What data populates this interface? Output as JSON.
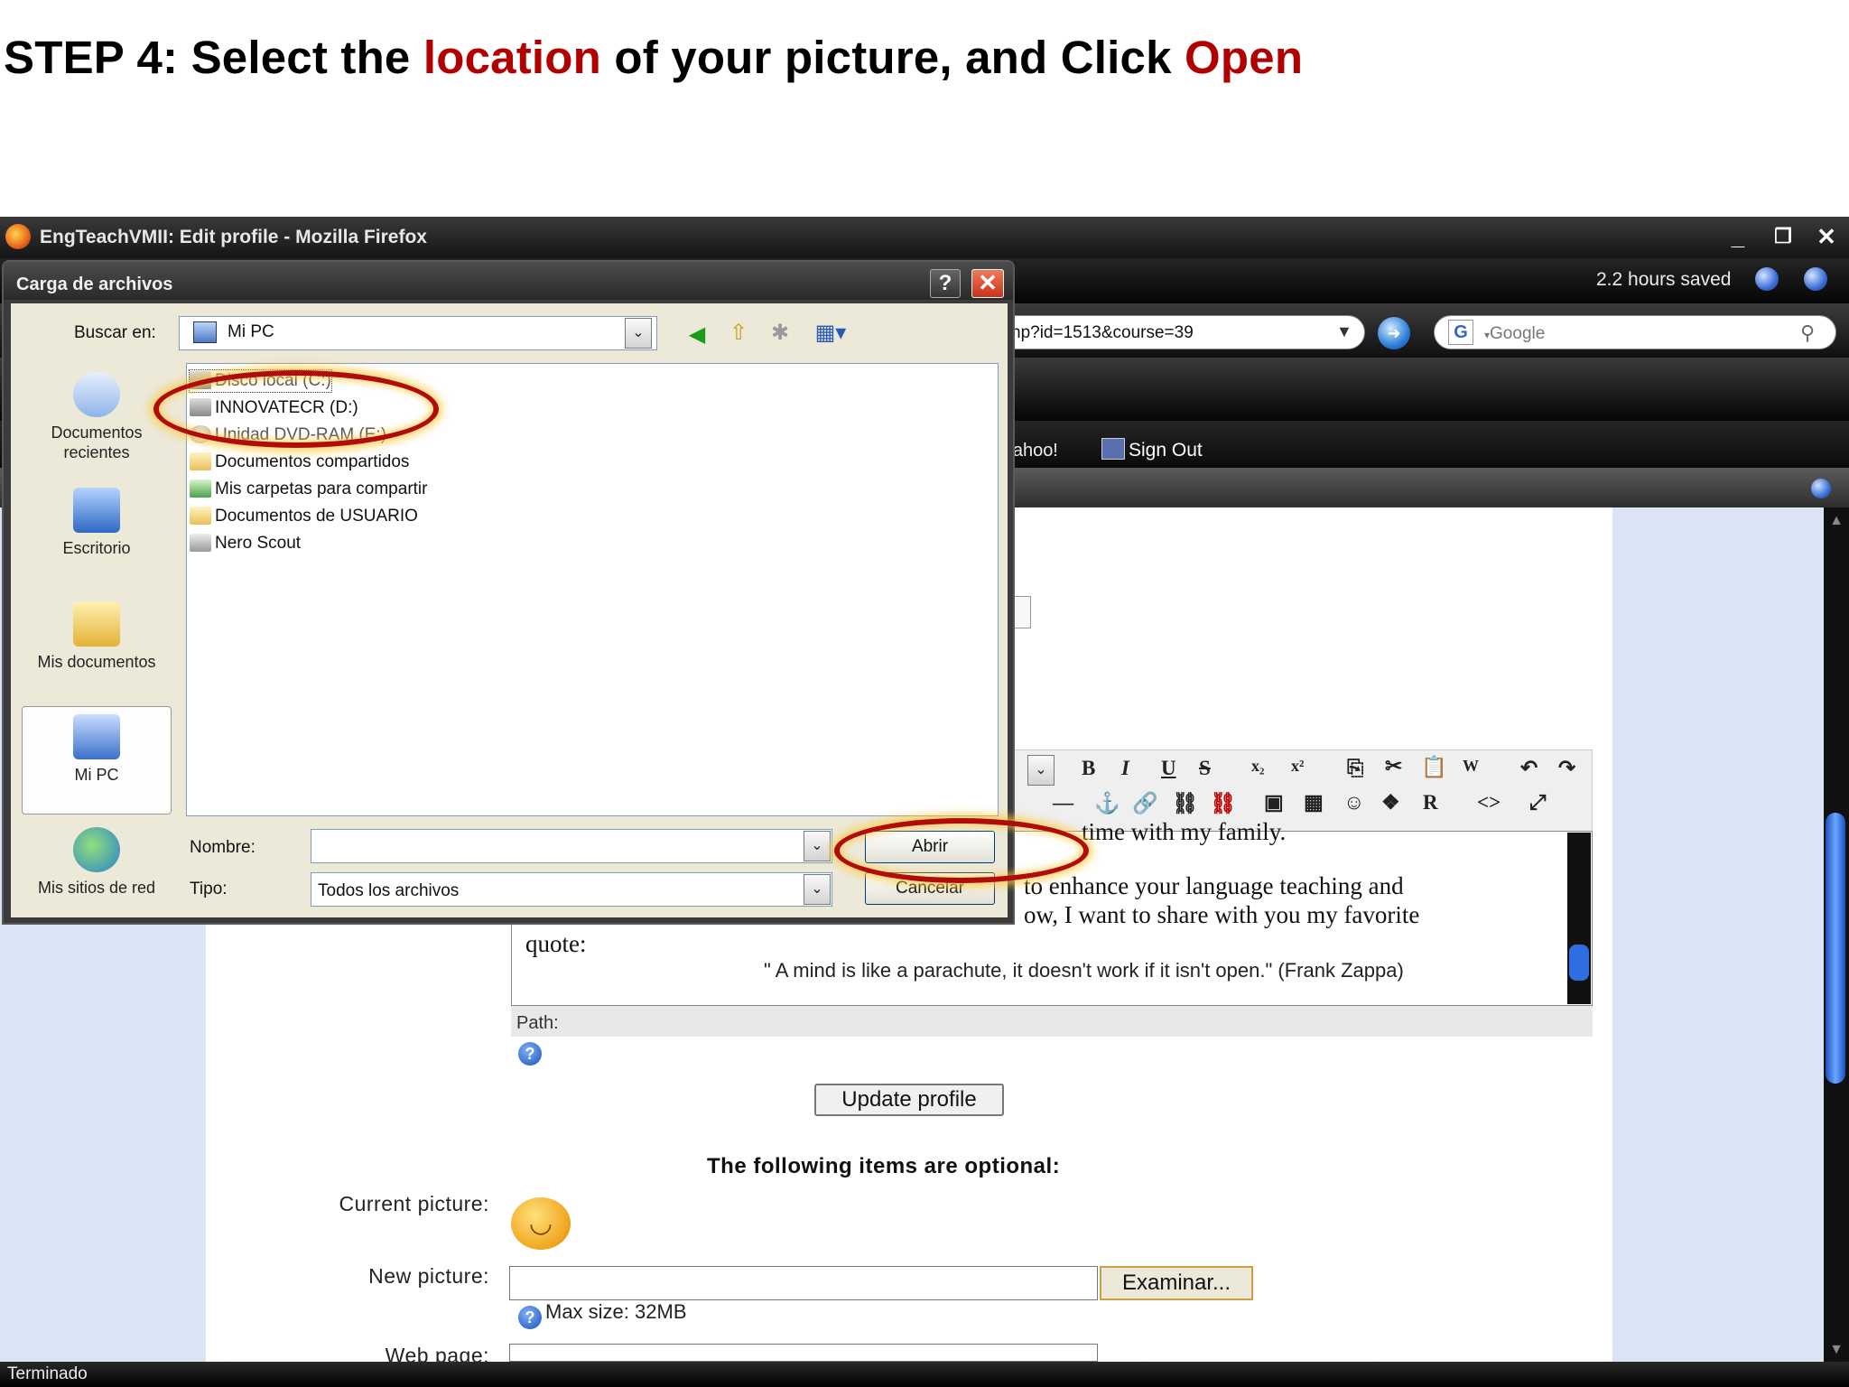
{
  "slide": {
    "title_part1": "STEP 4: Select the ",
    "title_hl1": "location",
    "title_part2": " of your picture, and Click ",
    "title_hl2": "Open",
    "accent_color": "#b00000"
  },
  "browser": {
    "window_title": "EngTeachVMII: Edit profile - Mozilla Firefox",
    "hours_saved": "2.2 hours saved",
    "url_visible": "np?id=1513&course=39",
    "search_engine": "Google",
    "bookmarks": {
      "yahoo": "'ahoo!",
      "sign_out": "Sign Out"
    },
    "status": "Terminado"
  },
  "dialog": {
    "title": "Carga de archivos",
    "look_in_label": "Buscar en:",
    "look_in_value": "Mi PC",
    "places": [
      "Documentos recientes",
      "Escritorio",
      "Mis documentos",
      "Mi PC",
      "Mis sitios de red"
    ],
    "places_selected": "Mi PC",
    "files": [
      {
        "name": "Disco local (C:)",
        "icon": "disk-icon"
      },
      {
        "name": "INNOVATECR (D:)",
        "icon": "disk-icon"
      },
      {
        "name": "Unidad DVD-RAM (E:)",
        "icon": "dvd-icon"
      },
      {
        "name": "Documentos compartidos",
        "icon": "folder-icon"
      },
      {
        "name": "Mis carpetas para compartir",
        "icon": "shared-folder-icon"
      },
      {
        "name": "Documentos de USUARIO",
        "icon": "folder-icon"
      },
      {
        "name": "Nero Scout",
        "icon": "nero-icon"
      }
    ],
    "name_label": "Nombre:",
    "name_value": "",
    "type_label": "Tipo:",
    "type_value": "Todos los archivos",
    "open_button": "Abrir",
    "cancel_button": "Cancelar"
  },
  "page": {
    "editor_line1": "time with my family.",
    "editor_line2": "to enhance your language teaching and",
    "editor_line3": "ow, I want to share with you my favorite",
    "editor_line4": "quote:",
    "editor_quote": "\" A mind is like a parachute, it doesn't work if it isn't open.\" (Frank Zappa)",
    "path_label": "Path:",
    "update_button": "Update profile",
    "optional_heading": "The following items are optional:",
    "current_picture_label": "Current picture:",
    "new_picture_label": "New picture:",
    "browse_button": "Examinar...",
    "max_size": "Max size: 32MB",
    "web_page_label": "Web page:"
  }
}
